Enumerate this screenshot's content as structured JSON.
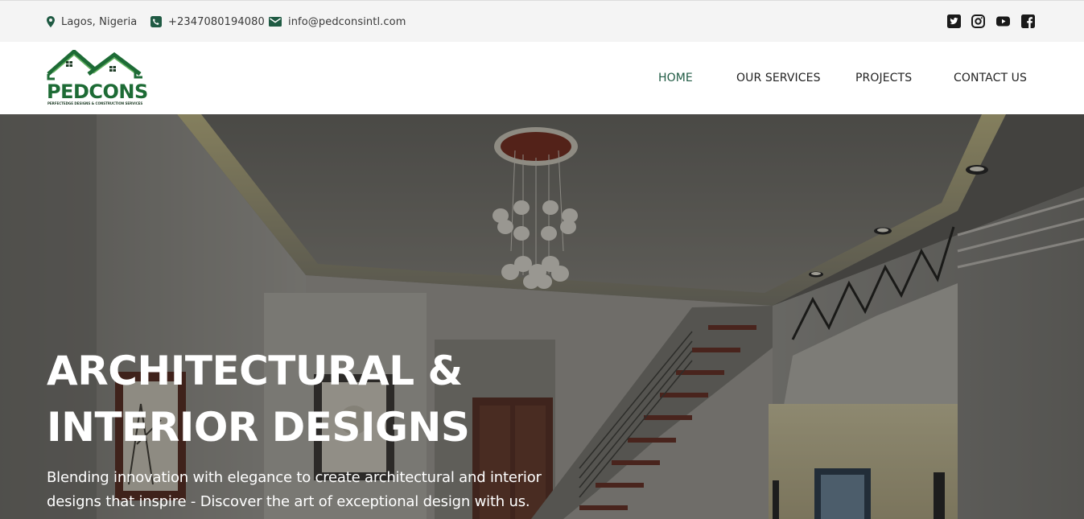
{
  "topbar": {
    "location": "Lagos, Nigeria",
    "phone": "+2347080194080",
    "email": "info@pedconsintl.com",
    "location_icon": "map-pin-icon",
    "phone_icon": "phone-icon",
    "email_icon": "envelope-icon",
    "socials": [
      "twitter-icon",
      "instagram-icon",
      "youtube-icon",
      "facebook-icon"
    ]
  },
  "logo": {
    "name": "PEDCONS",
    "tagline": "PERFECTEDGE DESIGNS & CONSTRUCTION SERVICES"
  },
  "nav": {
    "items": [
      "HOME",
      "OUR SERVICES",
      "PROJECTS",
      "CONTACT US"
    ],
    "active": "HOME"
  },
  "hero": {
    "title_line1": "ARCHITECTURAL &",
    "title_line2": "INTERIOR DESIGNS",
    "subtitle_line1": "Blending innovation with elegance to create architectural and interior",
    "subtitle_line2": "designs that inspire - Discover the art of exceptional design with us."
  },
  "colors": {
    "brand_green": "#1d6b35",
    "nav_active": "#1f5a43",
    "topbar_bg": "#f4f4f4",
    "icon_green": "#1f5a43"
  }
}
